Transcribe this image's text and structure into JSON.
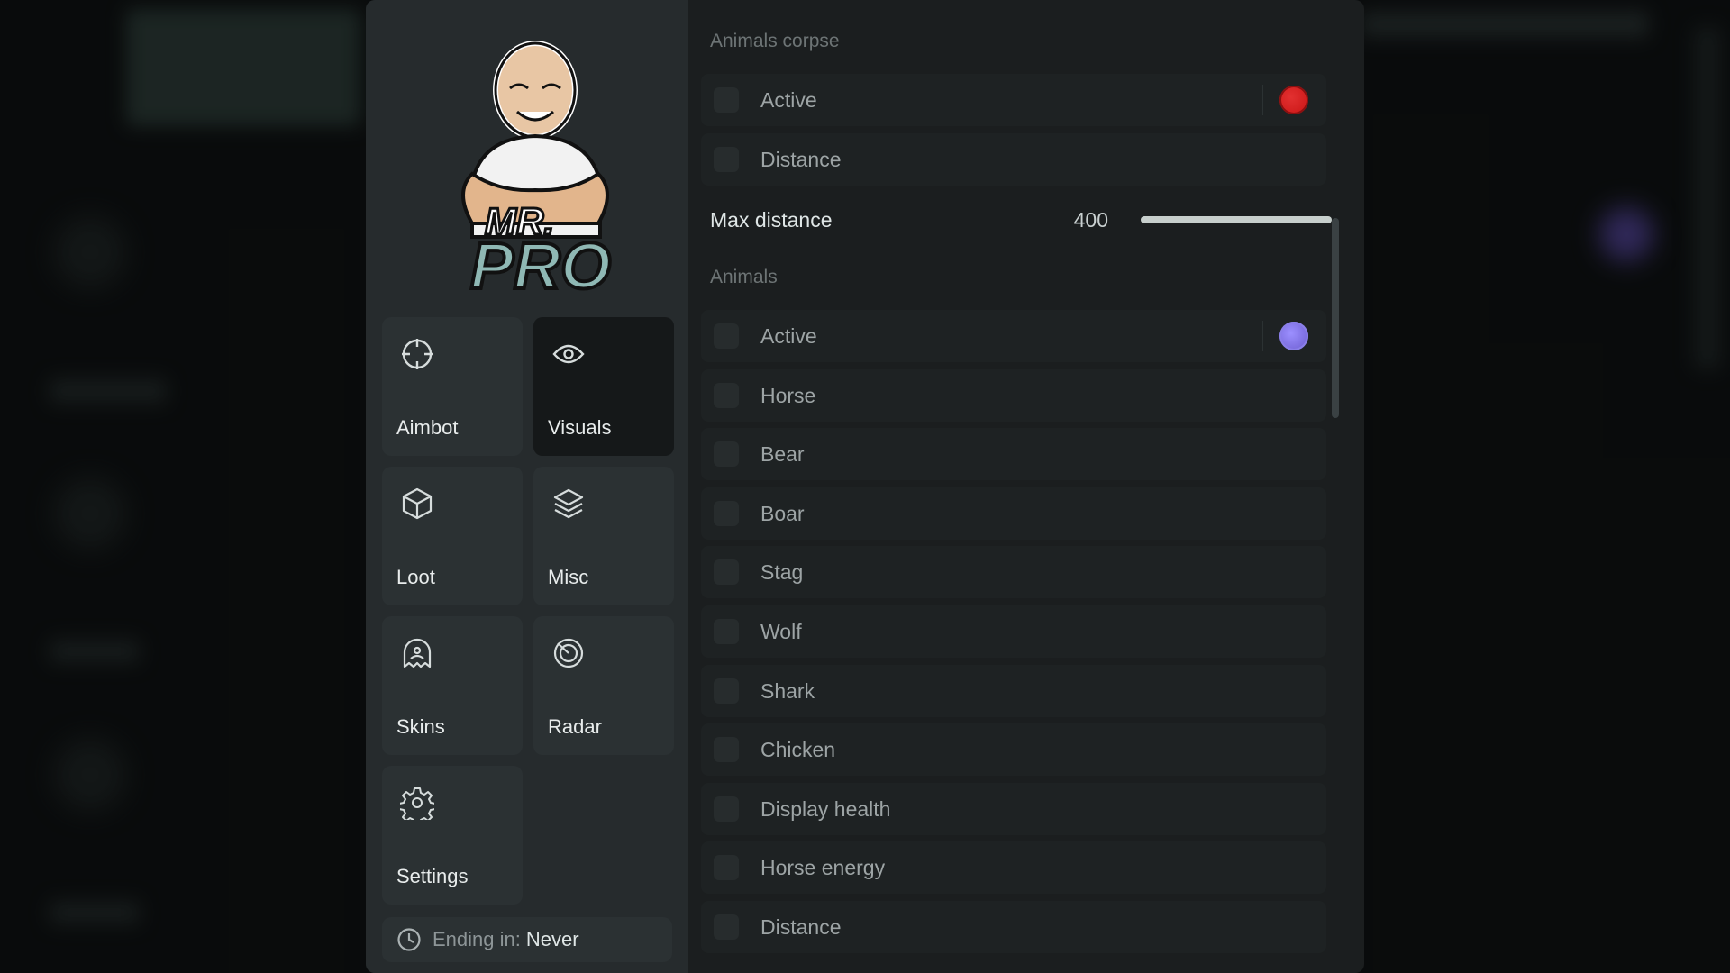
{
  "colors": {
    "corpse_active": "#c81414",
    "animals_active": "#6a5acd",
    "accent": "#cfd7d4"
  },
  "brand": {
    "logo_text_line1": "MR.",
    "logo_text_line2": "PRO"
  },
  "nav": {
    "tiles": [
      {
        "label": "Aimbot",
        "icon": "crosshair-icon",
        "active": false
      },
      {
        "label": "Visuals",
        "icon": "eye-icon",
        "active": true
      },
      {
        "label": "Loot",
        "icon": "cube-icon",
        "active": false
      },
      {
        "label": "Misc",
        "icon": "layers-icon",
        "active": false
      },
      {
        "label": "Skins",
        "icon": "ghost-icon",
        "active": false
      },
      {
        "label": "Radar",
        "icon": "radar-icon",
        "active": false
      },
      {
        "label": "Settings",
        "icon": "gear-icon",
        "active": false
      }
    ]
  },
  "footer": {
    "ending_label": "Ending in:",
    "ending_value": "Never"
  },
  "sections": {
    "corpse": {
      "title": "Animals corpse",
      "active_label": "Active",
      "distance_label": "Distance",
      "max_distance_label": "Max distance",
      "max_distance_value": "400",
      "max_distance_level": 1.0
    },
    "animals": {
      "title": "Animals",
      "rows": [
        "Active",
        "Horse",
        "Bear",
        "Boar",
        "Stag",
        "Wolf",
        "Shark",
        "Chicken",
        "Display health",
        "Horse energy",
        "Distance"
      ]
    }
  }
}
